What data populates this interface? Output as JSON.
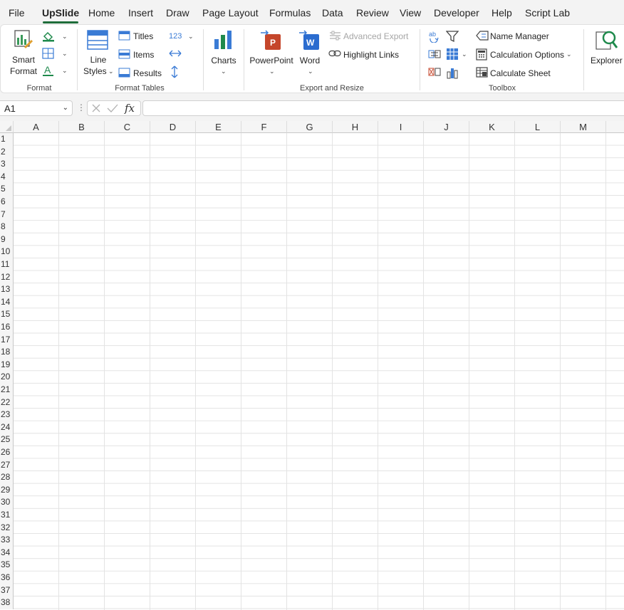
{
  "menu_tabs": [
    "File",
    "UpSlide",
    "Home",
    "Insert",
    "Draw",
    "Page Layout",
    "Formulas",
    "Data",
    "Review",
    "View",
    "Developer",
    "Help",
    "Script Lab"
  ],
  "active_tab": "UpSlide",
  "ribbon": {
    "format": {
      "smart_format_line1": "Smart",
      "smart_format_line2": "Format",
      "group_label": "Format"
    },
    "format_tables": {
      "line_styles_line1": "Line",
      "line_styles_line2": "Styles",
      "titles": "Titles",
      "items": "Items",
      "results": "Results",
      "number_format": "123",
      "group_label": "Format Tables"
    },
    "charts": {
      "label": "Charts"
    },
    "export": {
      "powerpoint": "PowerPoint",
      "word": "Word",
      "advanced_export": "Advanced Export",
      "highlight_links": "Highlight Links",
      "group_label": "Export and Resize"
    },
    "toolbox": {
      "name_manager": "Name Manager",
      "calculation_options": "Calculation Options",
      "calculate_sheet": "Calculate Sheet",
      "group_label": "Toolbox"
    },
    "explorer": {
      "label": "Explorer"
    }
  },
  "formula_bar": {
    "name_box": "A1",
    "fx": "fx",
    "formula": ""
  },
  "grid": {
    "columns": [
      "A",
      "B",
      "C",
      "D",
      "E",
      "F",
      "G",
      "H",
      "I",
      "J",
      "K",
      "L",
      "M"
    ],
    "rows": [
      "1",
      "2",
      "3",
      "4",
      "5",
      "6",
      "7",
      "8",
      "9",
      "10",
      "11",
      "12",
      "13",
      "14",
      "15",
      "16",
      "17",
      "18",
      "19",
      "20",
      "21",
      "22",
      "23",
      "24",
      "25",
      "26",
      "27",
      "28",
      "29",
      "30",
      "31",
      "32",
      "33",
      "34",
      "35",
      "36",
      "37",
      "38"
    ]
  },
  "colors": {
    "accent_green": "#1f6d3a",
    "ppt_orange": "#c5462b",
    "word_blue": "#2b6ccf",
    "table_blue": "#3a7bd5"
  }
}
